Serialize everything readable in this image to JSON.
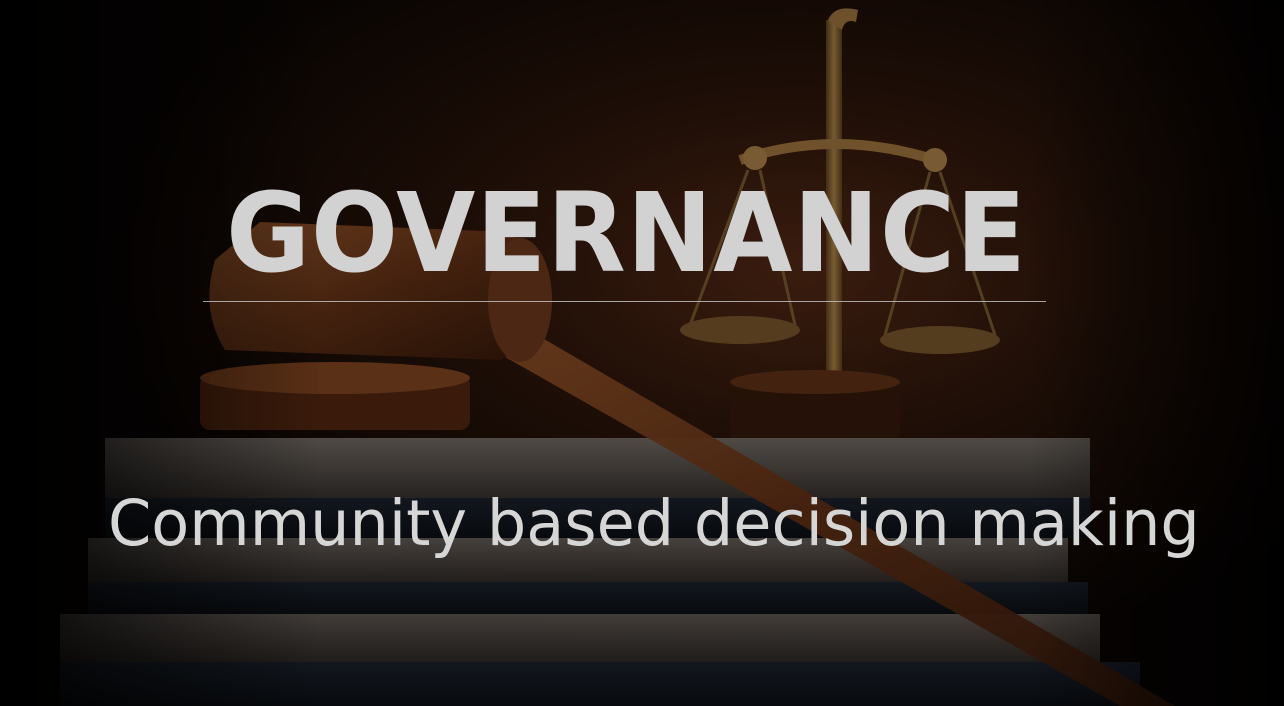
{
  "slide": {
    "title": "GOVERNANCE",
    "subtitle": "Community based decision making"
  },
  "background": {
    "image_subject": "gavel, scales of justice and stacked law books",
    "tone": "dark sepia"
  },
  "colors": {
    "title_text": "#d2d2d2",
    "subtitle_text": "#d6d6d6",
    "rule": "#bdbdbd",
    "background_dark": "#0b0604",
    "wood_accent": "#8a4a22"
  }
}
